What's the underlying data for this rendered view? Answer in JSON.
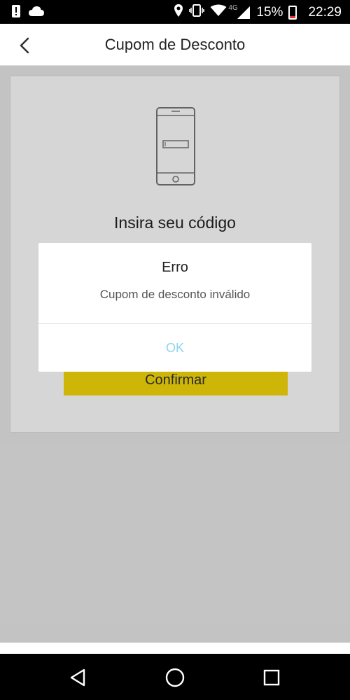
{
  "status_bar": {
    "battery_percent": "15%",
    "time": "22:29",
    "network": "4G",
    "icons": [
      "alert-icon",
      "cloud-icon",
      "location-icon",
      "vibrate-icon",
      "wifi-icon",
      "signal-icon",
      "battery-icon"
    ]
  },
  "app_bar": {
    "title": "Cupom de Desconto",
    "back_icon": "chevron-left-icon"
  },
  "card": {
    "heading": "Insira seu código",
    "confirm_label": "Confirmar",
    "illustration_icon": "phone-code-illustration-icon"
  },
  "dialog": {
    "title": "Erro",
    "message": "Cupom de desconto inválido",
    "ok_label": "OK"
  },
  "nav_bar": {
    "icons": [
      "back-triangle-icon",
      "home-circle-icon",
      "recents-square-icon"
    ]
  },
  "colors": {
    "accent_yellow": "#f6d90b",
    "ok_text": "#8fd3ef",
    "status_bar": "#000000"
  }
}
